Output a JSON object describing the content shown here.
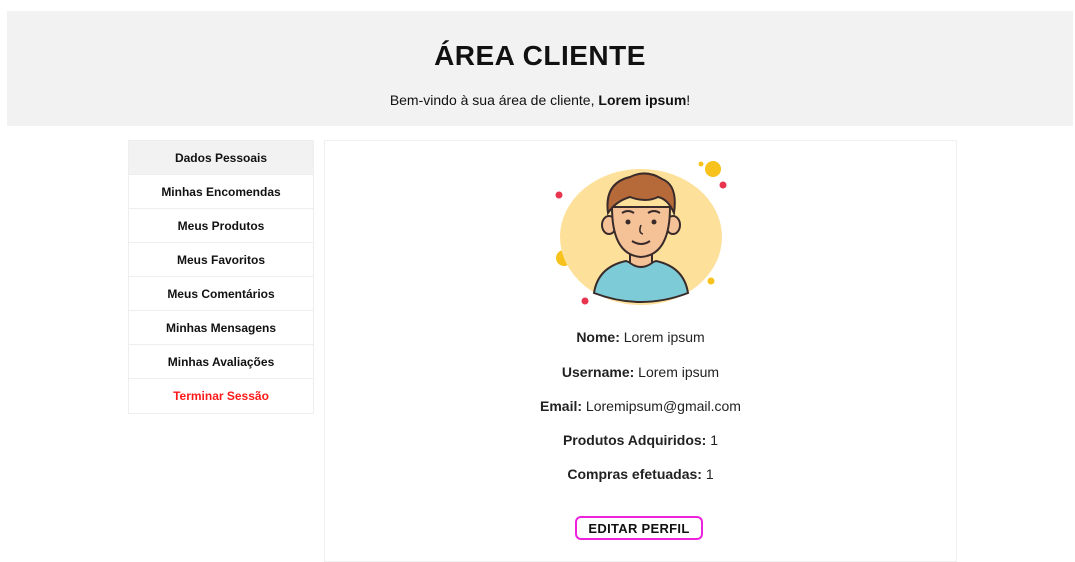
{
  "header": {
    "title": "ÁREA CLIENTE",
    "welcome_prefix": "Bem-vindo à sua área de cliente, ",
    "user_name": "Lorem ipsum",
    "welcome_suffix": "!"
  },
  "sidebar": {
    "items": [
      {
        "label": "Dados Pessoais"
      },
      {
        "label": "Minhas Encomendas"
      },
      {
        "label": "Meus Produtos"
      },
      {
        "label": "Meus Favoritos"
      },
      {
        "label": "Meus Comentários"
      },
      {
        "label": "Minhas Mensagens"
      },
      {
        "label": "Minhas Avaliações"
      },
      {
        "label": "Terminar Sessão"
      }
    ]
  },
  "profile": {
    "avatar_icon": "user-avatar-icon",
    "fields": [
      {
        "label": "Nome:",
        "value": "Lorem ipsum"
      },
      {
        "label": "Username:",
        "value": "Lorem ipsum"
      },
      {
        "label": "Email:",
        "value": "Loremipsum@gmail.com"
      },
      {
        "label": "Produtos Adquiridos:",
        "value": "1"
      },
      {
        "label": "Compras efetuadas:",
        "value": "1"
      }
    ],
    "edit_button": "EDITAR PERFIL"
  },
  "colors": {
    "logout": "#ff1a1a",
    "edit_border": "#ee22dd",
    "avatar_bg": "#fde09a",
    "shirt": "#7ccbd6"
  }
}
